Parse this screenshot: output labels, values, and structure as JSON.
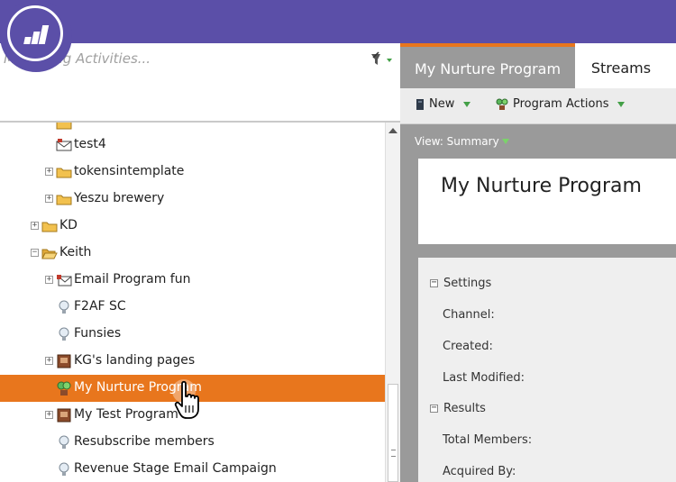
{
  "app": {
    "search_placeholder": "Marketing Activities...",
    "accent_color": "#e8761d",
    "brand_color": "#5b4fa8"
  },
  "tree": {
    "items": [
      {
        "label": "test4",
        "icon": "email-icon",
        "expander": ""
      },
      {
        "label": "tokensintemplate",
        "icon": "folder-icon",
        "expander": "+"
      },
      {
        "label": "Yeszu brewery",
        "icon": "folder-icon",
        "expander": "+"
      },
      {
        "label": "KD",
        "icon": "folder-icon",
        "expander": "+"
      },
      {
        "label": "Keith",
        "icon": "folder-open-icon",
        "expander": "−"
      },
      {
        "label": "Email Program fun",
        "icon": "email-program-icon",
        "expander": "+"
      },
      {
        "label": "F2AF SC",
        "icon": "lightbulb-icon",
        "expander": ""
      },
      {
        "label": "Funsies",
        "icon": "lightbulb-icon",
        "expander": ""
      },
      {
        "label": "KG's landing pages",
        "icon": "landing-page-icon",
        "expander": "+"
      },
      {
        "label": "My Nurture Program",
        "icon": "nurture-icon",
        "expander": "",
        "selected": true
      },
      {
        "label": "My Test Program",
        "icon": "program-icon",
        "expander": "+"
      },
      {
        "label": "Resubscribe members",
        "icon": "lightbulb-icon",
        "expander": ""
      },
      {
        "label": "Revenue Stage Email Campaign",
        "icon": "lightbulb-icon",
        "expander": ""
      }
    ]
  },
  "tabs": {
    "active": "My Nurture Program",
    "streams": "Streams"
  },
  "toolbar": {
    "new_label": "New",
    "program_actions_label": "Program Actions"
  },
  "view": {
    "label": "View: Summary"
  },
  "summary": {
    "title": "My Nurture Program",
    "settings_label": "Settings",
    "channel_label": "Channel:",
    "created_label": "Created:",
    "last_modified_label": "Last Modified:",
    "results_label": "Results",
    "total_members_label": "Total Members:",
    "acquired_by_label": "Acquired By:"
  }
}
